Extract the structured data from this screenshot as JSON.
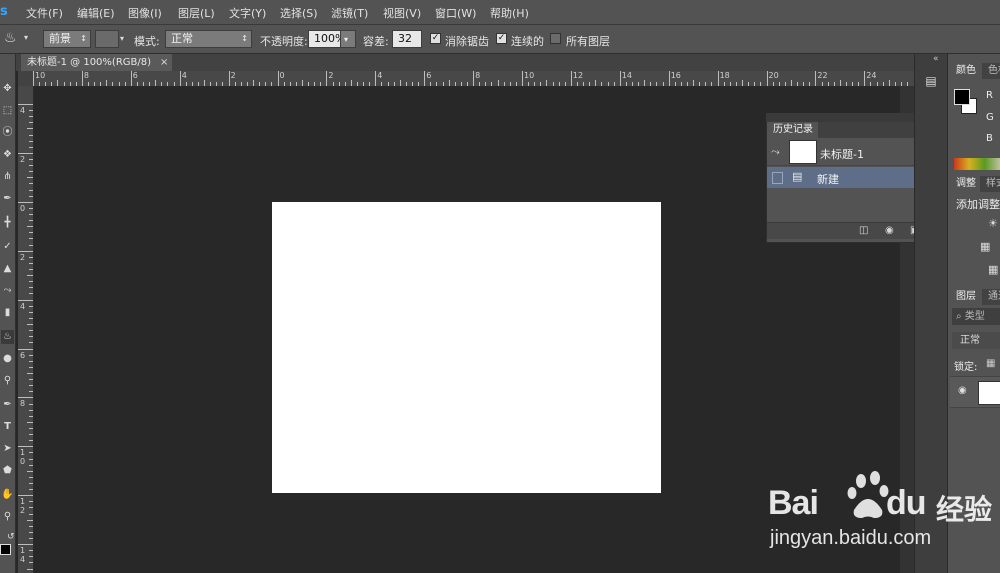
{
  "app": {
    "logo": "s"
  },
  "menu": [
    "文件(F)",
    "编辑(E)",
    "图像(I)",
    "图层(L)",
    "文字(Y)",
    "选择(S)",
    "滤镜(T)",
    "视图(V)",
    "窗口(W)",
    "帮助(H)"
  ],
  "options": {
    "fill_source": "前景",
    "mode_label": "模式:",
    "mode_value": "正常",
    "opacity_label": "不透明度:",
    "opacity_value": "100%",
    "tolerance_label": "容差:",
    "tolerance_value": "32",
    "anti_alias": {
      "label": "消除锯齿",
      "checked": true
    },
    "contiguous": {
      "label": "连续的",
      "checked": true
    },
    "all_layers": {
      "label": "所有图层",
      "checked": false
    }
  },
  "document": {
    "tab_title": "未标题-1 @ 100%(RGB/8)",
    "close_glyph": "×"
  },
  "rulers": {
    "horizontal": [
      "10",
      "8",
      "6",
      "4",
      "2",
      "0",
      "2",
      "4",
      "6",
      "8",
      "10",
      "12",
      "14",
      "16",
      "18",
      "20",
      "22",
      "24"
    ],
    "vertical": [
      "4",
      "2",
      "0",
      "2",
      "4",
      "6",
      "8",
      "1 0",
      "1 2",
      "1 4"
    ]
  },
  "history_panel": {
    "tab": "历史记录",
    "snapshot": "未标题-1",
    "steps": [
      "新建"
    ]
  },
  "right_panels": {
    "color_tabs": [
      "颜色",
      "色板"
    ],
    "channels": [
      "R",
      "G",
      "B"
    ],
    "adjust_tabs": [
      "调整",
      "样式"
    ],
    "adjust_label": "添加调整",
    "layers_tabs": [
      "图层",
      "通道"
    ],
    "layers_search": "类型",
    "layers_blend": "正常",
    "layers_lock": "锁定:"
  },
  "watermark": {
    "brand": "Bai",
    "brand2": "du",
    "cn": "经验",
    "url": "jingyan.baidu.com"
  },
  "colors": {
    "ui": "#535353",
    "workspace": "#282828",
    "canvas": "#ffffff",
    "history_selected": "#5e6e88"
  }
}
